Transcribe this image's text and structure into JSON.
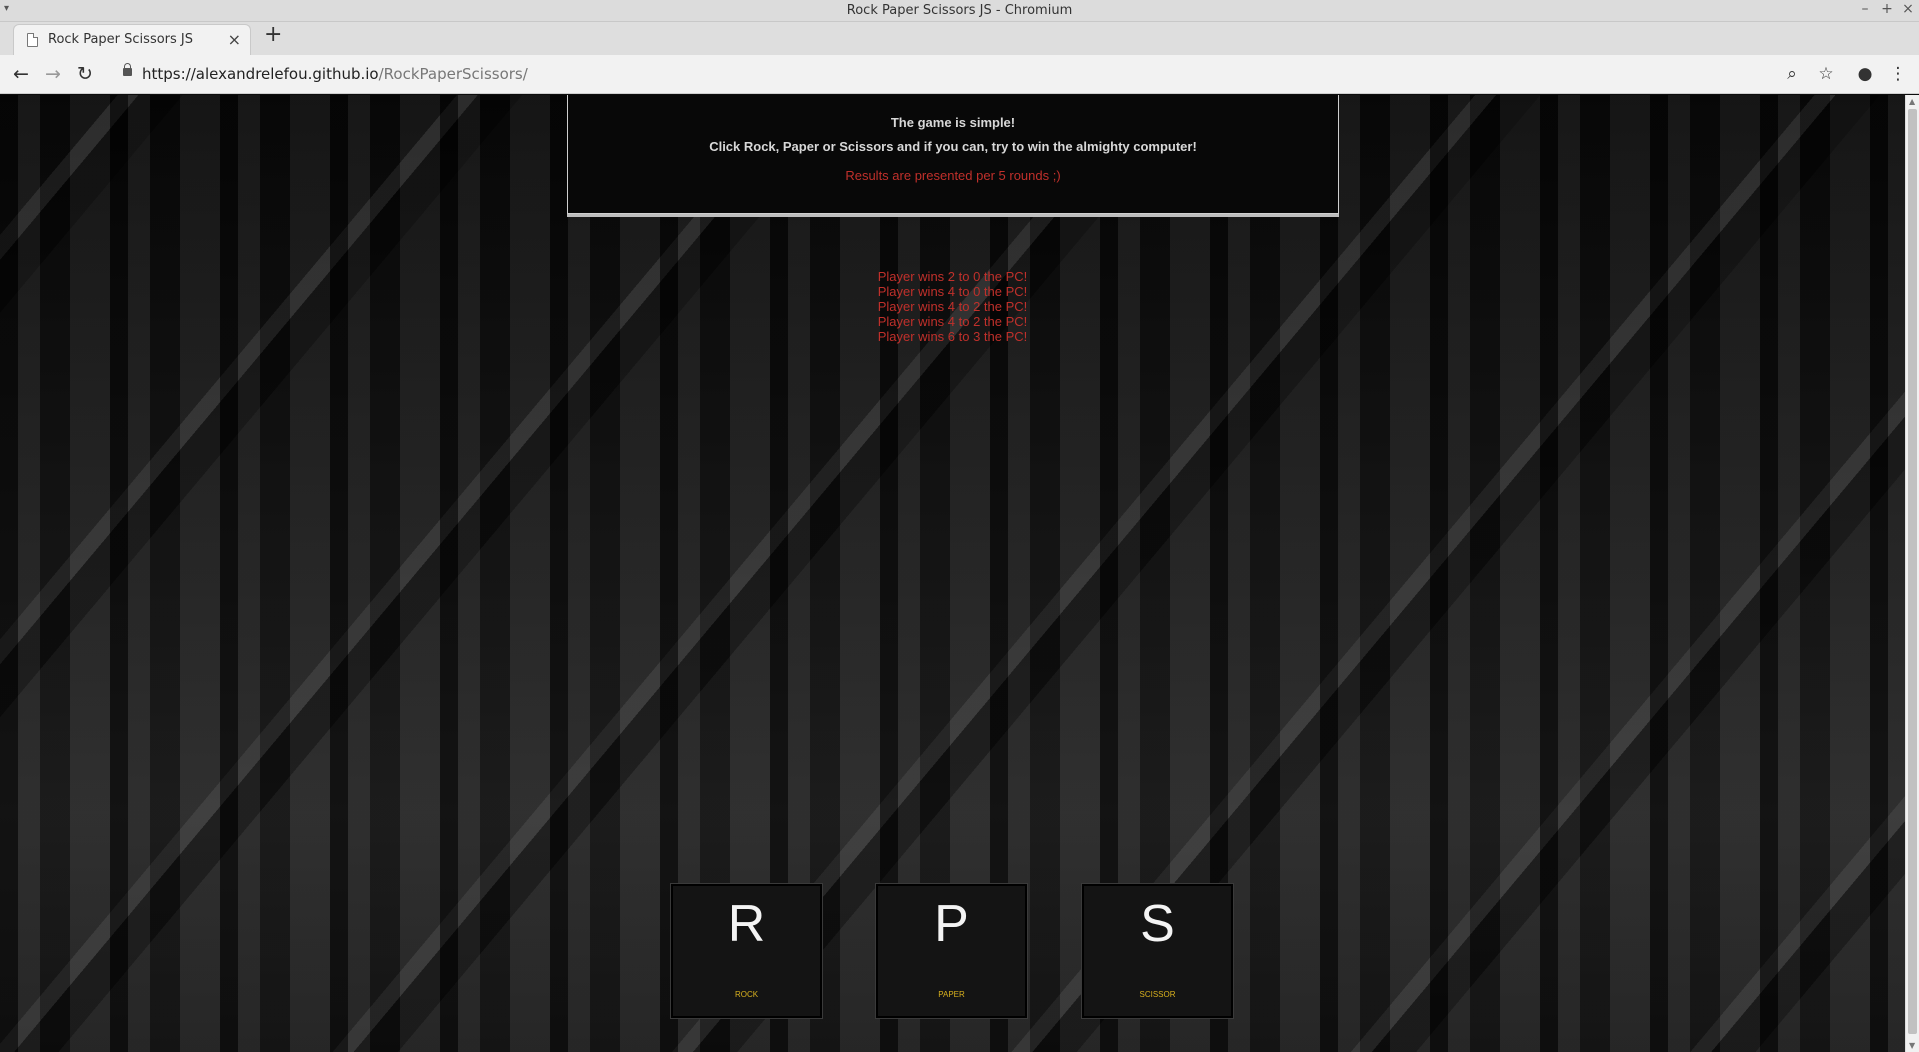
{
  "window": {
    "title": "Rock Paper Scissors JS - Chromium"
  },
  "tab": {
    "title": "Rock Paper Scissors JS",
    "close_glyph": "×"
  },
  "toolbar": {
    "url_host": "https://alexandrelefou.github.io",
    "url_path": "/RockPaperScissors/"
  },
  "intro": {
    "line1": "The game is simple!",
    "line2": "Click Rock, Paper or Scissors and if you can, try to win the almighty computer!",
    "note": "Results are presented per 5 rounds ;)"
  },
  "results": [
    "Player wins 2 to 0 the PC!",
    "Player wins 4 to 0 the PC!",
    "Player wins 4 to 2 the PC!",
    "Player wins 4 to 2 the PC!",
    "Player wins 6 to 3 the PC!"
  ],
  "choices": {
    "rock": {
      "letter": "R",
      "label": "ROCK"
    },
    "paper": {
      "letter": "P",
      "label": "PAPER"
    },
    "scissor": {
      "letter": "S",
      "label": "SCISSOR"
    }
  },
  "colors": {
    "accent_red": "#c0302b",
    "label_gold": "#d9b11e"
  }
}
